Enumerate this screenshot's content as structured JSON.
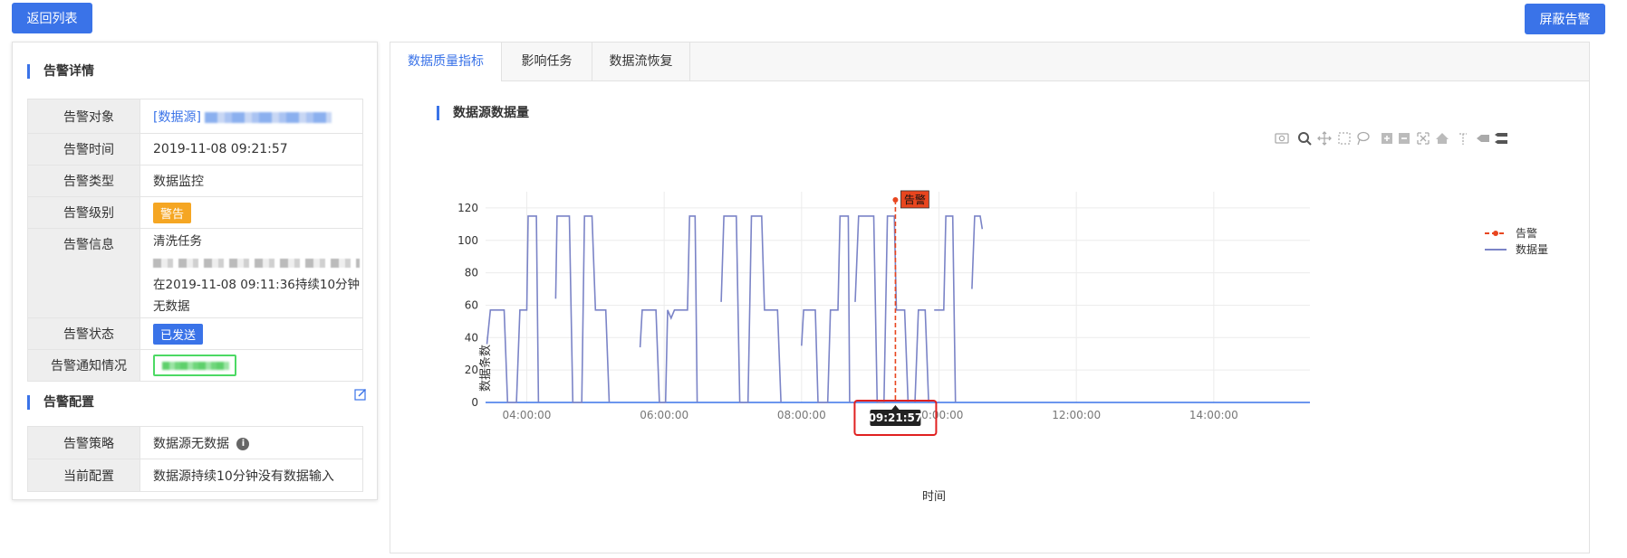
{
  "header": {
    "back_label": "返回列表",
    "mask_label": "屏蔽告警"
  },
  "alarm_detail": {
    "title": "告警详情",
    "rows": {
      "object": {
        "key": "告警对象",
        "value": "[数据源]"
      },
      "time": {
        "key": "告警时间",
        "value": "2019-11-08 09:21:57"
      },
      "type": {
        "key": "告警类型",
        "value": "数据监控"
      },
      "level": {
        "key": "告警级别",
        "value": "警告"
      },
      "info": {
        "key": "告警信息",
        "line1": "清洗任务",
        "line3": "在2019-11-08 09:11:36持续10分钟",
        "line4": "无数据"
      },
      "status": {
        "key": "告警状态",
        "value": "已发送"
      },
      "notify": {
        "key": "告警通知情况"
      }
    }
  },
  "alarm_config": {
    "title": "告警配置",
    "rows": {
      "strategy": {
        "key": "告警策略",
        "value": "数据源无数据"
      },
      "current": {
        "key": "当前配置",
        "value": "数据源持续10分钟没有数据输入"
      }
    }
  },
  "tabs": [
    "数据质量指标",
    "影响任务",
    "数据流恢复"
  ],
  "active_tab": 0,
  "chart_section_title": "数据源数据量",
  "colors": {
    "accent": "#3a73e8",
    "series": "#7b84c7",
    "alarm": "#e8461f",
    "warn": "#f5a623",
    "highlight_box": "#e02020"
  },
  "chart_data": {
    "type": "line",
    "ylabel": "数据条数",
    "xlabel": "时间",
    "ylim": [
      0,
      130
    ],
    "yticks": [
      0,
      20,
      40,
      60,
      80,
      100,
      120
    ],
    "xticks": [
      "04:00:00",
      "06:00:00",
      "08:00:00",
      "10:00:00",
      "12:00:00",
      "14:00:00"
    ],
    "x_range_hours": [
      3.4,
      15.4
    ],
    "grid": true,
    "legend": {
      "position": "top-right",
      "entries": [
        "告警",
        "数据量"
      ]
    },
    "alarm_marker": {
      "time": "09:21:57",
      "hour": 9.366,
      "label": "告警",
      "value": 125
    },
    "series": [
      {
        "name": "数据量",
        "segments": [
          [
            [
              3.42,
              36
            ],
            [
              3.47,
              57
            ],
            [
              3.67,
              57
            ],
            [
              3.72,
              0
            ],
            [
              3.85,
              0
            ],
            [
              3.9,
              57
            ],
            [
              4.0,
              57
            ],
            [
              4.02,
              115
            ],
            [
              4.14,
              115
            ],
            [
              4.17,
              0
            ]
          ],
          [
            [
              4.42,
              64
            ],
            [
              4.44,
              115
            ],
            [
              4.62,
              115
            ],
            [
              4.67,
              0
            ],
            [
              4.8,
              0
            ],
            [
              4.84,
              115
            ],
            [
              4.95,
              115
            ],
            [
              5.0,
              57
            ],
            [
              5.15,
              57
            ],
            [
              5.2,
              0
            ]
          ],
          [
            [
              5.65,
              34
            ],
            [
              5.68,
              57
            ],
            [
              5.88,
              57
            ],
            [
              5.93,
              0
            ],
            [
              6.02,
              0
            ],
            [
              6.05,
              57
            ],
            [
              6.1,
              52
            ],
            [
              6.15,
              57
            ],
            [
              6.34,
              57
            ],
            [
              6.37,
              115
            ],
            [
              6.45,
              115
            ],
            [
              6.48,
              0
            ]
          ],
          [
            [
              6.83,
              62
            ],
            [
              6.87,
              115
            ],
            [
              7.05,
              115
            ],
            [
              7.1,
              0
            ],
            [
              7.22,
              0
            ],
            [
              7.27,
              115
            ],
            [
              7.42,
              115
            ],
            [
              7.46,
              57
            ],
            [
              7.65,
              57
            ],
            [
              7.7,
              0
            ]
          ],
          [
            [
              8.0,
              35
            ],
            [
              8.03,
              57
            ],
            [
              8.2,
              57
            ],
            [
              8.24,
              0
            ],
            [
              8.38,
              0
            ],
            [
              8.42,
              57
            ],
            [
              8.53,
              57
            ],
            [
              8.56,
              115
            ],
            [
              8.68,
              115
            ],
            [
              8.7,
              0
            ]
          ],
          [
            [
              8.78,
              62
            ],
            [
              8.83,
              115
            ],
            [
              9.05,
              115
            ],
            [
              9.1,
              0
            ],
            [
              9.2,
              0
            ],
            [
              9.25,
              115
            ],
            [
              9.35,
              115
            ],
            [
              9.38,
              57
            ],
            [
              9.5,
              57
            ],
            [
              9.55,
              0
            ]
          ],
          [
            [
              9.65,
              0
            ],
            [
              9.7,
              57
            ],
            [
              9.8,
              57
            ],
            [
              9.85,
              0
            ]
          ],
          [
            [
              9.93,
              57
            ],
            [
              10.07,
              57
            ],
            [
              10.1,
              115
            ],
            [
              10.2,
              115
            ],
            [
              10.24,
              0
            ]
          ],
          [
            [
              10.48,
              70
            ],
            [
              10.52,
              115
            ],
            [
              10.6,
              115
            ],
            [
              10.63,
              107
            ]
          ]
        ]
      }
    ]
  }
}
